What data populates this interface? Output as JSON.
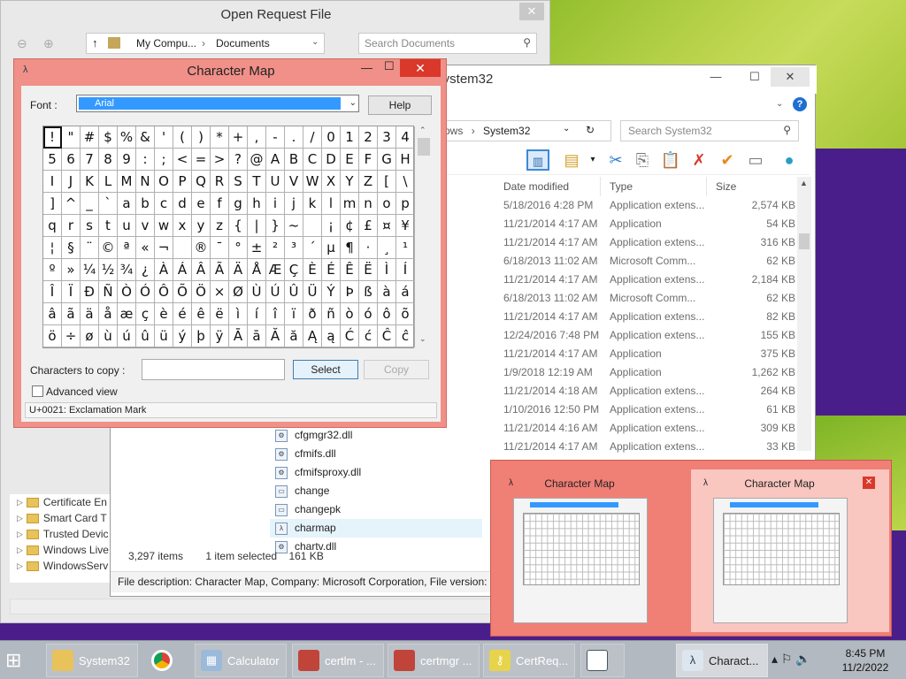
{
  "open_request": {
    "title": "Open Request File",
    "breadcrumb": [
      "My Compu...",
      "Documents"
    ],
    "search_placeholder": "Search Documents",
    "tree": [
      "Certificate En",
      "Smart Card T",
      "Trusted Devic",
      "Windows Live",
      "WindowsServ"
    ]
  },
  "system32": {
    "title": "System32",
    "address": [
      "ows",
      "System32"
    ],
    "search_placeholder": "Search System32",
    "columns": {
      "date": "Date modified",
      "type": "Type",
      "size": "Size"
    },
    "rows": [
      {
        "date": "5/18/2016 4:28 PM",
        "type": "Application extens...",
        "size": "2,574 KB"
      },
      {
        "date": "11/21/2014 4:17 AM",
        "type": "Application",
        "size": "54 KB"
      },
      {
        "date": "11/21/2014 4:17 AM",
        "type": "Application extens...",
        "size": "316 KB"
      },
      {
        "date": "6/18/2013 11:02 AM",
        "type": "Microsoft Comm...",
        "size": "62 KB"
      },
      {
        "date": "11/21/2014 4:17 AM",
        "type": "Application extens...",
        "size": "2,184 KB"
      },
      {
        "date": "6/18/2013 11:02 AM",
        "type": "Microsoft Comm...",
        "size": "62 KB"
      },
      {
        "date": "11/21/2014 4:17 AM",
        "type": "Application extens...",
        "size": "82 KB"
      },
      {
        "date": "12/24/2016 7:48 PM",
        "type": "Application extens...",
        "size": "155 KB"
      },
      {
        "date": "11/21/2014 4:17 AM",
        "type": "Application",
        "size": "375 KB"
      },
      {
        "date": "1/9/2018 12:19 AM",
        "type": "Application",
        "size": "1,262 KB"
      },
      {
        "date": "11/21/2014 4:18 AM",
        "type": "Application extens...",
        "size": "264 KB"
      },
      {
        "date": "1/10/2016 12:50 PM",
        "type": "Application extens...",
        "size": "61 KB"
      },
      {
        "date": "11/21/2014 4:16 AM",
        "type": "Application extens...",
        "size": "309 KB"
      },
      {
        "date": "11/21/2014 4:17 AM",
        "type": "Application extens...",
        "size": "33 KB"
      }
    ],
    "files": [
      "cfgmgr32.dll",
      "cfmifs.dll",
      "cfmifsproxy.dll",
      "change",
      "changepk",
      "charmap",
      "chartv.dll"
    ],
    "status_count": "3,297 items",
    "status_selected": "1 item selected",
    "status_size": "161 KB",
    "description": "File description: Character Map, Company: Microsoft Corporation, File version: 5"
  },
  "charmap": {
    "title": "Character Map",
    "font_label": "Font :",
    "font_value": "Arial",
    "help_label": "Help",
    "chars": "!\"#$%&'()*+,-./0123456789:;<=>?@ABCDEFGHIJKLMNOPQRSTUVWXYZ[\\]^_`abcdefghijklmnopqrstuvwxyz{|}~ ¡¢£¤¥¦§¨©ª«¬­®¯°±²³´µ¶·¸¹º»¼½¾¿ÀÁÂÃÄÅÆÇÈÉÊËÌÍÎÏÐÑÒÓÔÕÖ×ØÙÚÛÜÝÞßàáâãäåæçèéêëìíîïðñòóôõö÷øùúûüýþÿĀāĂăĄąĆćĈĉ",
    "copy_label": "Characters to copy :",
    "select_label": "Select",
    "copy_button": "Copy",
    "advanced_label": "Advanced view",
    "status": "U+0021: Exclamation Mark"
  },
  "thumbnails": [
    "Character Map",
    "Character Map"
  ],
  "taskbar": {
    "items": [
      "System32",
      "",
      "Calculator",
      "certlm - ...",
      "certmgr ...",
      "CertReq...",
      "",
      "Charact..."
    ],
    "time": "8:45 PM",
    "date": "11/2/2022"
  },
  "colors": {
    "accent": "#3399ff",
    "cmap_frame": "#f09088",
    "close_red": "#d9382b"
  }
}
